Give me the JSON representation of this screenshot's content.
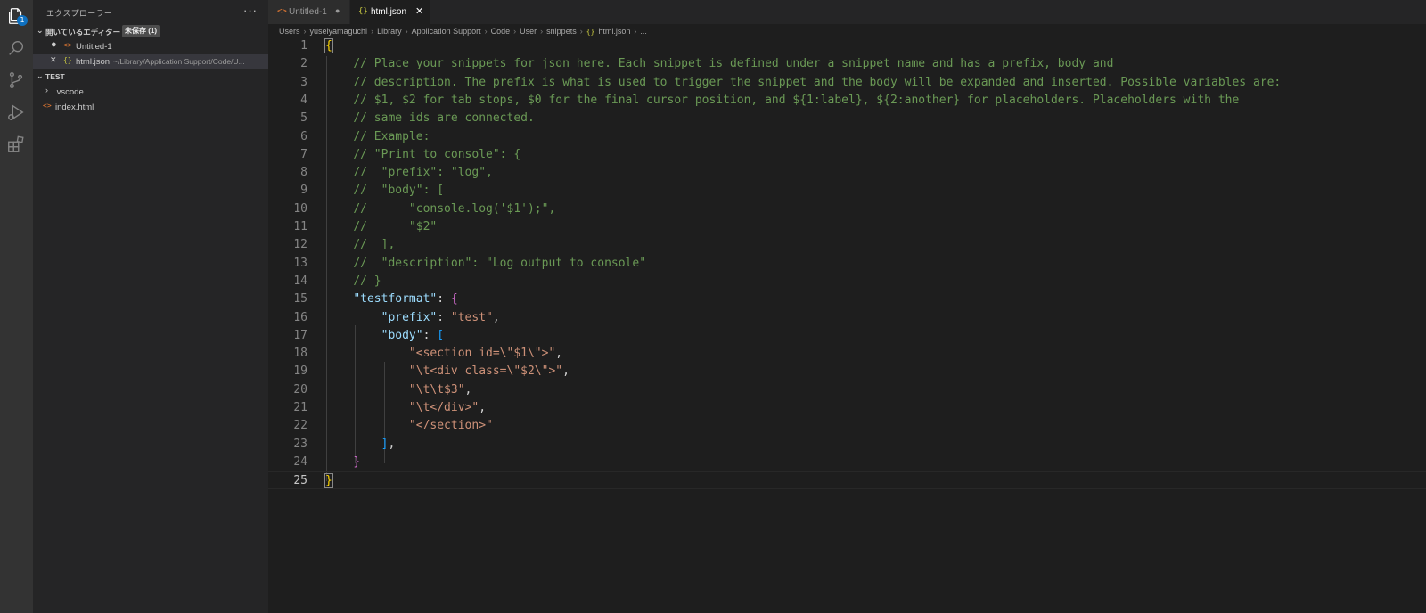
{
  "activity": {
    "explorer_badge": "1",
    "icons": [
      "files-icon",
      "search-icon",
      "source-control-icon",
      "run-debug-icon",
      "extensions-icon"
    ]
  },
  "sidebar": {
    "title": "エクスプローラー",
    "more": "···",
    "open_editors": {
      "label": "開いているエディター",
      "unsaved_badge": "未保存 (1)",
      "items": [
        {
          "name": "Untitled-1",
          "path": "",
          "modified": true
        },
        {
          "name": "html.json",
          "path": "~/Library/Application Support/Code/U...",
          "modified": false
        }
      ]
    },
    "workspace": {
      "label": "TEST",
      "items": [
        {
          "name": ".vscode",
          "type": "folder"
        },
        {
          "name": "index.html",
          "type": "html"
        }
      ]
    }
  },
  "tabs": [
    {
      "label": "Untitled-1",
      "active": false,
      "modified": true
    },
    {
      "label": "html.json",
      "active": true,
      "modified": false
    }
  ],
  "breadcrumb": [
    "Users",
    "yuseiyamaguchi",
    "Library",
    "Application Support",
    "Code",
    "User",
    "snippets",
    "html.json",
    "..."
  ],
  "colors": {
    "comment": "#6a9955",
    "key": "#9cdcfe",
    "string": "#ce9178",
    "bracket_level1": "#ffd700",
    "bracket_level2": "#da70d6",
    "bracket_level3": "#179fff",
    "accent": "#0e70c0"
  },
  "editor": {
    "current_line": 25,
    "lines": [
      "{",
      "    // Place your snippets for json here. Each snippet is defined under a snippet name and has a prefix, body and",
      "    // description. The prefix is what is used to trigger the snippet and the body will be expanded and inserted. Possible variables are:",
      "    // $1, $2 for tab stops, $0 for the final cursor position, and ${1:label}, ${2:another} for placeholders. Placeholders with the",
      "    // same ids are connected.",
      "    // Example:",
      "    // \"Print to console\": {",
      "    //  \"prefix\": \"log\",",
      "    //  \"body\": [",
      "    //      \"console.log('$1');\",",
      "    //      \"$2\"",
      "    //  ],",
      "    //  \"description\": \"Log output to console\"",
      "    // }",
      "    \"testformat\": {",
      "        \"prefix\": \"test\",",
      "        \"body\": [",
      "            \"<section id=\\\"$1\\\">\",",
      "            \"\\t<div class=\\\"$2\\\">\",",
      "            \"\\t\\t$3\",",
      "            \"\\t</div>\",",
      "            \"</section>\"",
      "        ],",
      "    }",
      "}"
    ]
  }
}
